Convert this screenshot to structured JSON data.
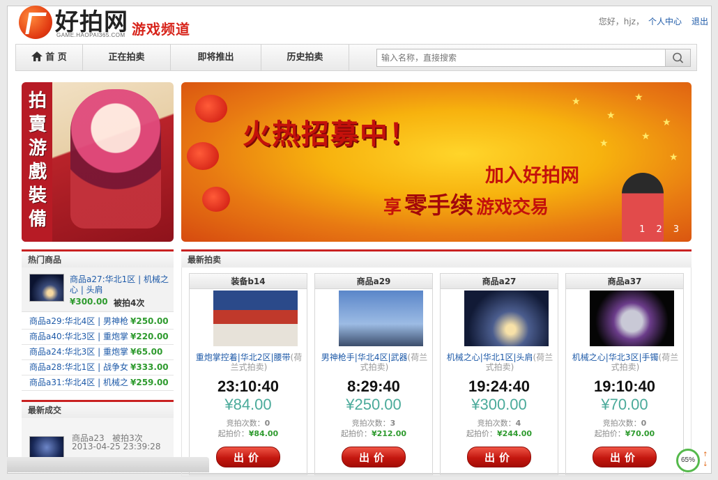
{
  "header": {
    "brand": "好拍网",
    "brand_sub": "GAME.HAOPAI365.COM",
    "channel": "游戏频道",
    "greeting": "您好，hjz，",
    "user_center": "个人中心",
    "logout": "退出"
  },
  "nav": {
    "home": "首 页",
    "items": [
      "正在拍卖",
      "即将推出",
      "历史拍卖"
    ],
    "search_placeholder": "输入名称，直接搜索"
  },
  "side_banner": {
    "text": "拍賣游戲裝備"
  },
  "main_banner": {
    "headline": "火热招募中！",
    "line2": "加入好拍网",
    "line3_pre": "享",
    "line3_em": "零手续",
    "line3_post": "游戏交易",
    "pager": [
      "1",
      "2",
      "3"
    ]
  },
  "hot": {
    "title": "热门商品",
    "top": {
      "name": "商品a27:华北1区 | 机械之心 | 头肩",
      "price": "¥300.00",
      "bids": "被拍4次"
    },
    "items": [
      {
        "name": "商品a29:华北4区 | 男神枪",
        "price": "¥250.00"
      },
      {
        "name": "商品a40:华北3区 | 重炮掌",
        "price": "¥220.00"
      },
      {
        "name": "商品a24:华北3区 | 重炮掌",
        "price": "¥65.00"
      },
      {
        "name": "商品a28:华北1区 | 战争女",
        "price": "¥333.00"
      },
      {
        "name": "商品a31:华北4区 | 机械之",
        "price": "¥259.00"
      }
    ]
  },
  "deal": {
    "title": "最新成交",
    "name": "商品a23",
    "bids": "被拍3次",
    "time": "2013-04-25 23:39:28"
  },
  "latest": {
    "title": "最新拍卖",
    "cards": [
      {
        "head": "装备b14",
        "title": "重炮掌控着|华北2区|腰带",
        "type": "(荷兰式拍卖)",
        "timer": "23:10:40",
        "price": "¥84.00",
        "count_label": "竞拍次数：",
        "count": "0",
        "start_label": "起拍价：",
        "start": "¥84.00",
        "button": "出价"
      },
      {
        "head": "商品a29",
        "title": "男神枪手|华北4区|武器",
        "type": "(荷兰式拍卖)",
        "timer": "8:29:40",
        "price": "¥250.00",
        "count_label": "竞拍次数：",
        "count": "3",
        "start_label": "起拍价：",
        "start": "¥212.00",
        "button": "出价"
      },
      {
        "head": "商品a27",
        "title": "机械之心|华北1区|头肩",
        "type": "(荷兰式拍卖)",
        "timer": "19:24:40",
        "price": "¥300.00",
        "count_label": "竞拍次数：",
        "count": "4",
        "start_label": "起拍价：",
        "start": "¥244.00",
        "button": "出价"
      },
      {
        "head": "商品a37",
        "title": "机械之心|华北3区|手镯",
        "type": "(荷兰式拍卖)",
        "timer": "19:10:40",
        "price": "¥70.00",
        "count_label": "竞拍次数：",
        "count": "0",
        "start_label": "起拍价：",
        "start": "¥70.00",
        "button": "出价"
      }
    ]
  },
  "overlay": {
    "percent": "65%"
  },
  "colors": {
    "accent": "#c92222",
    "link": "#1e5aa8",
    "price_green": "#2f9b2f",
    "teal_price": "#4aaa9a"
  }
}
